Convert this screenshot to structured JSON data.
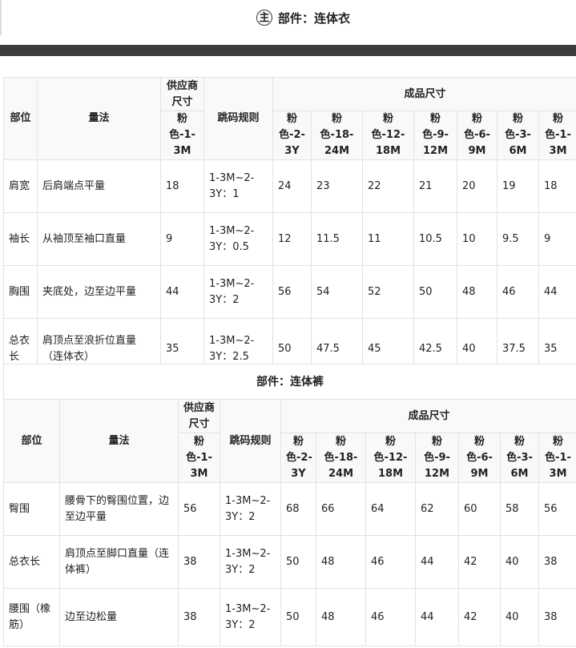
{
  "header": {
    "badge": "主",
    "title": "部件：连体衣"
  },
  "table1": {
    "h_part": "部位",
    "h_method": "量法",
    "h_supplier": "供应商尺寸",
    "h_rule": "跳码规则",
    "h_finished": "成品尺寸",
    "supplier_size": "粉色-1-3M",
    "sizes": [
      "粉色-2-3Y",
      "粉色-18-24M",
      "粉色-12-18M",
      "粉色-9-12M",
      "粉色-6-9M",
      "粉色-3-6M",
      "粉色-1-3M"
    ],
    "rows": [
      {
        "part": "肩宽",
        "method": "后肩端点平量",
        "supplier": "18",
        "rule": "1-3M~2-3Y：1",
        "values": [
          "24",
          "23",
          "22",
          "21",
          "20",
          "19",
          "18"
        ]
      },
      {
        "part": "袖长",
        "method": "从袖顶至袖口直量",
        "supplier": "9",
        "rule": "1-3M~2-3Y：0.5",
        "values": [
          "12",
          "11.5",
          "11",
          "10.5",
          "10",
          "9.5",
          "9"
        ]
      },
      {
        "part": "胸围",
        "method": "夹底处，边至边平量",
        "supplier": "44",
        "rule": "1-3M~2-3Y：2",
        "values": [
          "56",
          "54",
          "52",
          "50",
          "48",
          "46",
          "44"
        ]
      },
      {
        "part": "总衣长",
        "method": "肩顶点至浪折位直量（连体衣）",
        "supplier": "35",
        "rule": "1-3M~2-3Y：2.5",
        "values": [
          "50",
          "47.5",
          "45",
          "42.5",
          "40",
          "37.5",
          "35"
        ]
      }
    ]
  },
  "section2_title": "部件：连体裤",
  "table2": {
    "h_part": "部位",
    "h_method": "量法",
    "h_supplier": "供应商尺寸",
    "h_rule": "跳码规则",
    "h_finished": "成品尺寸",
    "supplier_size": "粉色-1-3M",
    "sizes": [
      "粉色-2-3Y",
      "粉色-18-24M",
      "粉色-12-18M",
      "粉色-9-12M",
      "粉色-6-9M",
      "粉色-3-6M",
      "粉色-1-3M"
    ],
    "rows": [
      {
        "part": "臀围",
        "method": "腰骨下的臀围位置，边至边平量",
        "supplier": "56",
        "rule": "1-3M~2-3Y：2",
        "values": [
          "68",
          "66",
          "64",
          "62",
          "60",
          "58",
          "56"
        ]
      },
      {
        "part": "总衣长",
        "method": "肩顶点至脚口直量（连体裤）",
        "supplier": "38",
        "rule": "1-3M~2-3Y：2",
        "values": [
          "50",
          "48",
          "46",
          "44",
          "42",
          "40",
          "38"
        ]
      },
      {
        "part": "腰围（橡筋）",
        "method": "边至边松量",
        "supplier": "38",
        "rule": "1-3M~2-3Y：2",
        "values": [
          "50",
          "48",
          "46",
          "44",
          "42",
          "40",
          "38"
        ]
      }
    ]
  }
}
